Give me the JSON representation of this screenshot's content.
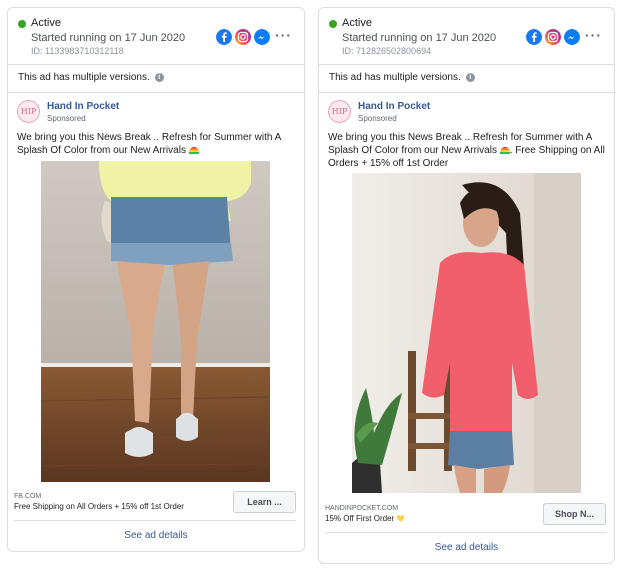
{
  "colors": {
    "active_dot": "#36a420",
    "link": "#385898",
    "border": "#dadde1"
  },
  "ads": [
    {
      "status": "Active",
      "started": "Started running on 17 Jun 2020",
      "id": "ID: 1133983710312118",
      "platforms": [
        "facebook-icon",
        "instagram-icon",
        "messenger-icon"
      ],
      "multiple_versions": "This ad has multiple versions.",
      "advertiser_logo": "HIP",
      "advertiser": "Hand In Pocket",
      "sponsored": "Sponsored",
      "body": "We bring you this News Break .. Refresh for Summer with A Splash Of Color from our New Arrivals",
      "body_emoji": "rainbow",
      "image": "model in denim shorts and yellow sweatshirt",
      "cta_domain": "FB.COM",
      "cta_text": "Free Shipping on All Orders + 15% off 1st Order",
      "cta_button": "Learn ...",
      "see_details": "See ad details"
    },
    {
      "status": "Active",
      "started": "Started running on 17 Jun 2020",
      "id": "ID: 712826502800694",
      "platforms": [
        "facebook-icon",
        "instagram-icon",
        "messenger-icon"
      ],
      "multiple_versions": "This ad has multiple versions.",
      "advertiser_logo": "HIP",
      "advertiser": "Hand In Pocket",
      "sponsored": "Sponsored",
      "body": "We bring you this News Break .. Refresh for Summer with A Splash Of Color from our New Arrivals",
      "body_emoji": "rainbow",
      "body_suffix": ". Free Shipping on All Orders + 15% off 1st Order",
      "image": "model in coral top and denim shorts",
      "cta_domain": "HANDINPOCKET.COM",
      "cta_text": "15% Off First Order",
      "cta_button": "Shop N...",
      "see_details": "See ad details"
    }
  ]
}
